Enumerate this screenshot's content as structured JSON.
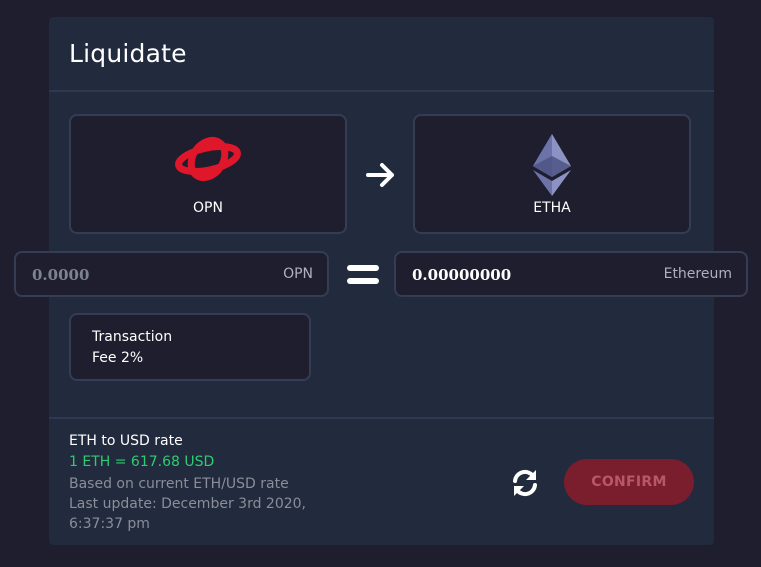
{
  "card": {
    "title": "Liquidate"
  },
  "from_token": {
    "name": "OPN",
    "icon": "opn-logo",
    "color": "#e0172b"
  },
  "to_token": {
    "name": "ETHA",
    "icon": "ethereum-logo"
  },
  "from_amount": {
    "value": "0.0000",
    "unit": "OPN"
  },
  "to_amount": {
    "value": "0.00000000",
    "unit": "Ethereum"
  },
  "fee": {
    "text": "Transaction Fee 2%"
  },
  "rate": {
    "title": "ETH to USD rate",
    "value": "1 ETH = 617.68 USD",
    "based_on": "Based on current ETH/USD rate",
    "last_update": "Last update: December 3rd 2020, 6:37:37 pm"
  },
  "actions": {
    "confirm_label": "CONFIRM",
    "refresh_icon": "refresh-icon"
  },
  "colors": {
    "background": "#1e1e2f",
    "card": "#222a3d",
    "accent_green": "#2ecc71",
    "confirm_button": "#7a1d2c"
  }
}
